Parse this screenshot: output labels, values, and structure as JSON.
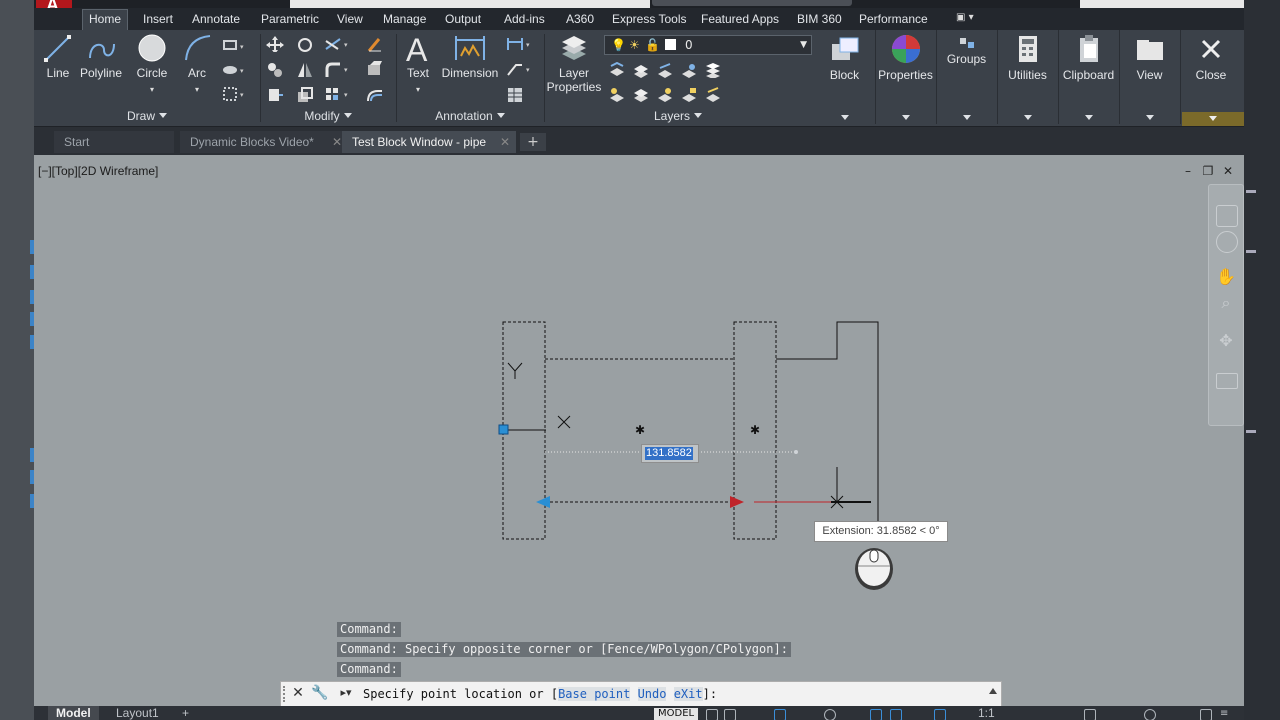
{
  "ribbon_tabs": [
    "Home",
    "Insert",
    "Annotate",
    "Parametric",
    "View",
    "Manage",
    "Output",
    "Add-ins",
    "A360",
    "Express Tools",
    "Featured Apps",
    "BIM 360",
    "Performance"
  ],
  "draw_panel": {
    "line": "Line",
    "polyline": "Polyline",
    "circle": "Circle",
    "arc": "Arc",
    "title": "Draw"
  },
  "modify_panel": {
    "title": "Modify"
  },
  "annotation_panel": {
    "text": "Text",
    "dimension": "Dimension",
    "title": "Annotation"
  },
  "layers_panel": {
    "layer_properties_line1": "Layer",
    "layer_properties_line2": "Properties",
    "current_layer": "0",
    "title": "Layers"
  },
  "right_panels": {
    "block": "Block",
    "properties": "Properties",
    "groups": "Groups",
    "utilities": "Utilities",
    "clipboard": "Clipboard",
    "view": "View",
    "close": "Close"
  },
  "doc_tabs": [
    {
      "label": "Start",
      "active": false,
      "closable": false
    },
    {
      "label": "Dynamic Blocks Video*",
      "active": false,
      "closable": true
    },
    {
      "label": "Test Block Window - pipe",
      "active": true,
      "closable": true
    }
  ],
  "viewport": {
    "label": "[−][Top][2D Wireframe]",
    "dynamic_input_value": "131.8582",
    "tooltip": "Extension: 31.8582 < 0°",
    "ucs_y": "Y"
  },
  "command": {
    "history": [
      "Command:",
      "Command: Specify opposite corner or [Fence/WPolygon/CPolygon]:",
      "Command:"
    ],
    "prompt_prefix": "Specify point location or [",
    "option1": "Base point",
    "option2": "Undo",
    "option3": "eXit",
    "prompt_suffix": "]:"
  },
  "status": {
    "model_tab": "Model",
    "layout_tab": "Layout1",
    "model_chip": "MODEL",
    "scale": "1:1"
  },
  "colors": {
    "accent_blue": "#3270c7",
    "grip_red": "#c0242a",
    "grip_blue": "#2a8fd4",
    "ribbon_bg": "#3b4149",
    "canvas_bg": "#9aa0a3"
  }
}
